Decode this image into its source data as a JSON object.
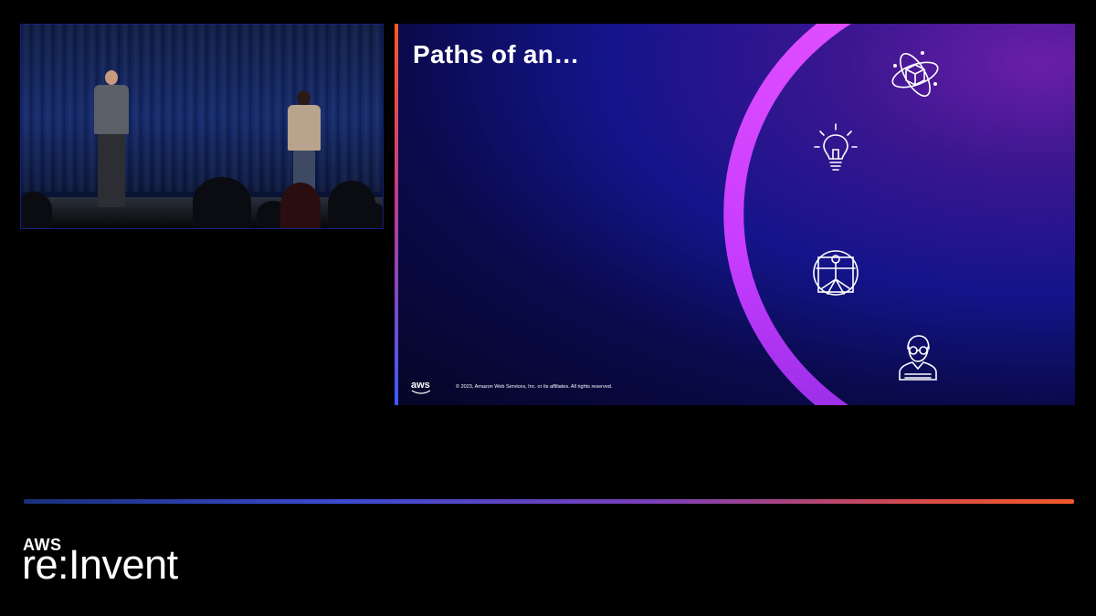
{
  "slide": {
    "title": "Paths of an…",
    "aws_mark": "aws",
    "copyright": "© 2023, Amazon Web Services, Inc. or its affiliates. All rights reserved."
  },
  "branding": {
    "aws": "AWS",
    "event": "re:Invent"
  },
  "icons": [
    "atom-cube-icon",
    "lightbulb-icon",
    "vitruvian-man-icon",
    "person-glasses-icon"
  ],
  "colors": {
    "accent_purple": "#cc3cff",
    "divider_start": "#1a2f7a",
    "divider_end": "#f25a2a"
  }
}
